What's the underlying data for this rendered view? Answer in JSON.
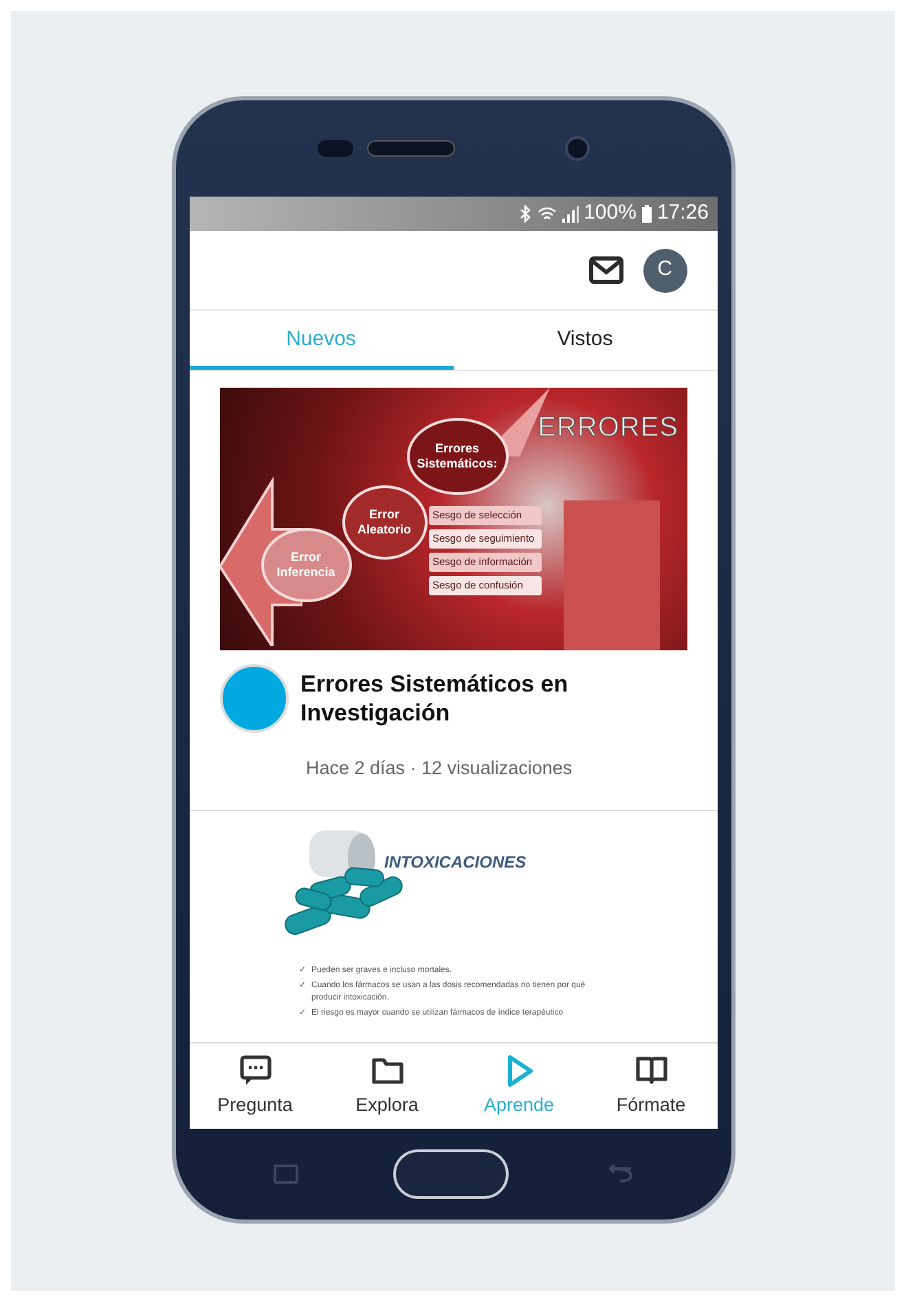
{
  "status_bar": {
    "battery": "100%",
    "time": "17:26"
  },
  "header": {
    "avatar_letter": "C"
  },
  "tabs": [
    {
      "label": "Nuevos",
      "selected": true
    },
    {
      "label": "Vistos",
      "selected": false
    }
  ],
  "posts": [
    {
      "kind": "diagram",
      "slide": {
        "title": "ERRORES",
        "nodes": [
          "Errores Sistemáticos:",
          "Error Aleatorio",
          "Error Inferencia"
        ],
        "biases": [
          "Sesgo de selección",
          "Sesgo de seguimiento",
          "Sesgo de información",
          "Sesgo de confusión"
        ]
      },
      "title": "Errores Sistemáticos en Investigación",
      "meta": "Hace 2 días · 12 visualizaciones"
    },
    {
      "kind": "pills",
      "slide": {
        "title": "INTOXICACIONES",
        "bullet_mark": "✓",
        "bullets": [
          "Pueden ser graves e incluso mortales.",
          "Cuando los fármacos se usan a las dosis recomendadas no tienen por qué producir intoxicación.",
          "El riesgo es mayor cuando se utilizan fármacos de índice terapéutico"
        ]
      }
    }
  ],
  "nav": [
    {
      "kind": "chat",
      "label": "Pregunta",
      "selected": false
    },
    {
      "kind": "folder",
      "label": "Explora",
      "selected": false
    },
    {
      "kind": "play",
      "label": "Aprende",
      "selected": true
    },
    {
      "kind": "book",
      "label": "Fórmate",
      "selected": false
    }
  ]
}
